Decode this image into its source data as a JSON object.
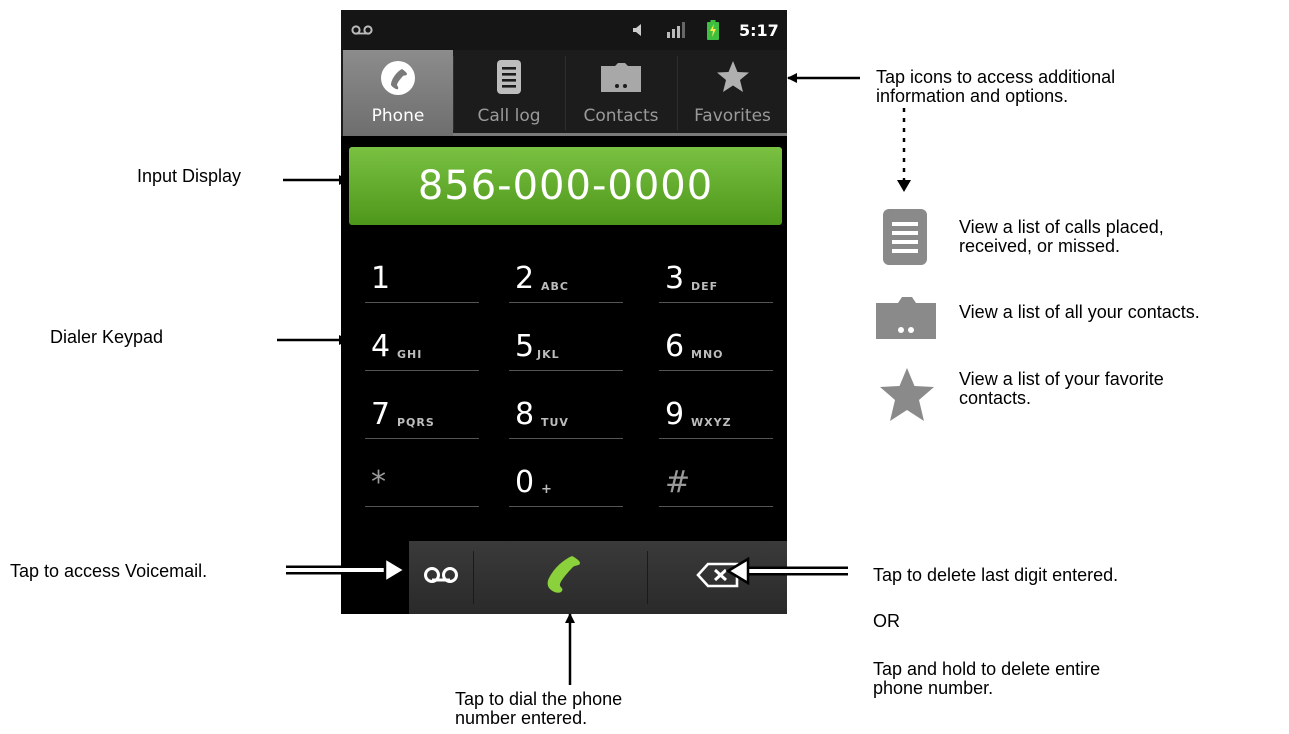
{
  "status_bar": {
    "time": "5:17",
    "voicemail_icon": "voicemail-icon",
    "volume_icon": "speaker-icon",
    "signal_icon": "signal-bars-icon",
    "battery_icon": "battery-charging-icon"
  },
  "tabs": [
    {
      "label": "Phone",
      "icon": "phone-handset-icon",
      "active": true
    },
    {
      "label": "Call log",
      "icon": "call-log-list-icon",
      "active": false
    },
    {
      "label": "Contacts",
      "icon": "contacts-folder-icon",
      "active": false
    },
    {
      "label": "Favorites",
      "icon": "star-icon",
      "active": false
    }
  ],
  "input_display": {
    "value": "856-000-0000"
  },
  "keypad": [
    {
      "digit": "1",
      "letters": ""
    },
    {
      "digit": "2",
      "letters": "ABC"
    },
    {
      "digit": "3",
      "letters": "DEF"
    },
    {
      "digit": "4",
      "letters": "GHI"
    },
    {
      "digit": "5",
      "letters": "JKL"
    },
    {
      "digit": "6",
      "letters": "MNO"
    },
    {
      "digit": "7",
      "letters": "PQRS"
    },
    {
      "digit": "8",
      "letters": "TUV"
    },
    {
      "digit": "9",
      "letters": "WXYZ"
    },
    {
      "digit": "*",
      "letters": ""
    },
    {
      "digit": "0",
      "letters": "+"
    },
    {
      "digit": "#",
      "letters": ""
    }
  ],
  "bottom_bar": {
    "voicemail": "voicemail-icon",
    "dial": "phone-handset-icon",
    "delete": "backspace-icon"
  },
  "annotations": {
    "tabs_note_line1": "Tap icons to access additional",
    "tabs_note_line2": "information and options.",
    "call_log_note_line1": "View a list of calls placed,",
    "call_log_note_line2": "received, or missed.",
    "contacts_note": "View a list of all your contacts.",
    "favorites_note_line1": "View a list of your favorite",
    "favorites_note_line2": "contacts.",
    "input_display": "Input Display",
    "dialer_keypad": "Dialer Keypad",
    "voicemail": "Tap to access Voicemail.",
    "delete_line1": "Tap to delete last digit entered.",
    "or": "OR",
    "hold_line1": "Tap and hold to delete entire",
    "hold_line2": "phone number.",
    "dial_line1": "Tap to dial the phone",
    "dial_line2": "number entered."
  },
  "colors": {
    "display_green": "#5fab2a",
    "dial_green": "#8bd13b",
    "legend_icon_gray": "#8a8a8a"
  }
}
